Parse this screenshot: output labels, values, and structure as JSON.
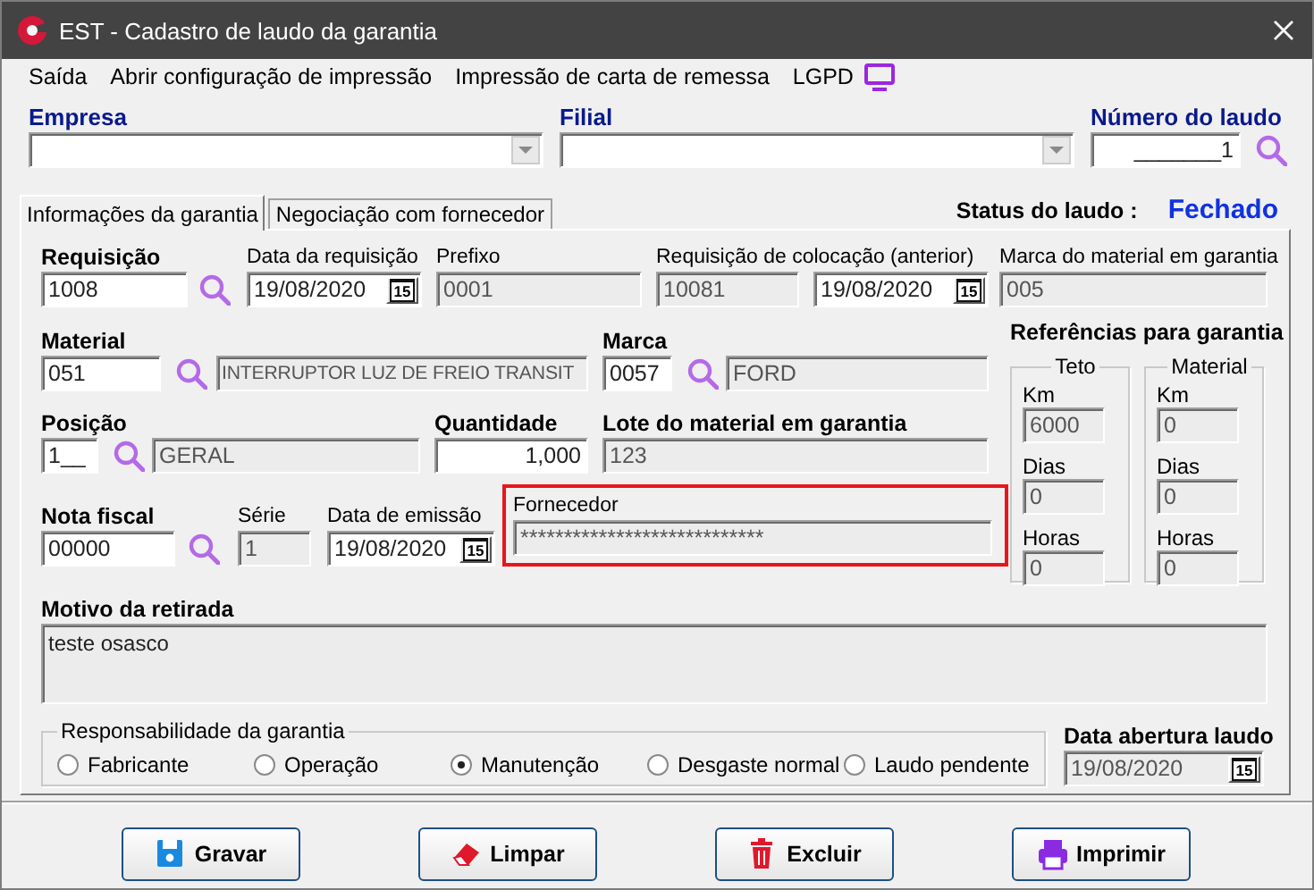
{
  "window": {
    "title": "EST - Cadastro de laudo da garantia"
  },
  "menu": [
    {
      "label": "Saída",
      "kind": "text"
    },
    {
      "label": "Abrir configuração de impressão",
      "kind": "text"
    },
    {
      "label": "Impressão de carta de remessa",
      "kind": "text"
    },
    {
      "label": "LGPD",
      "kind": "text_with_icon"
    }
  ],
  "header": {
    "empresa": {
      "label": "Empresa"
    },
    "filial": {
      "label": "Filial"
    },
    "numero_laudo": {
      "label": "Número do laudo",
      "value": "_______1"
    }
  },
  "tabs": [
    {
      "label": "Informações da garantia",
      "selected": true
    },
    {
      "label": "Negociação com fornecedor",
      "selected": false
    }
  ],
  "status": {
    "label": "Status do laudo :",
    "value": "Fechado"
  },
  "form": {
    "requisicao": {
      "label": "Requisição",
      "value": "1008",
      "bold": true,
      "disabled": false
    },
    "data_requisicao": {
      "label": "Data da requisição",
      "value": "19/08/2020",
      "button": "15",
      "bold": false,
      "disabled": false
    },
    "prefixo": {
      "label": "Prefixo",
      "value": "0001",
      "bold": false,
      "disabled": true
    },
    "requisicao_colocacao": {
      "label": "Requisição de colocação (anterior)",
      "value": "10081",
      "bold": false,
      "disabled": true
    },
    "data_colocacao": {
      "value": "19/08/2020",
      "button": "15",
      "disabled": false
    },
    "marca_material": {
      "label": "Marca do material em garantia",
      "value": "005",
      "bold": false,
      "disabled": true
    },
    "material": {
      "label": "Material",
      "value": "051",
      "bold": true,
      "disabled": false
    },
    "material_descricao": {
      "value": "INTERRUPTOR LUZ DE FREIO TRANSIT",
      "disabled": true
    },
    "marca": {
      "label": "Marca",
      "value": "0057",
      "bold": true,
      "disabled": false
    },
    "marca_descricao": {
      "value": "FORD",
      "disabled": true
    },
    "posicao": {
      "label": "Posição",
      "value": "1__",
      "bold": true,
      "disabled": false
    },
    "posicao_descricao": {
      "value": "GERAL",
      "disabled": true
    },
    "quantidade": {
      "label": "Quantidade",
      "value": "1,000",
      "bold": true,
      "disabled": false
    },
    "lote": {
      "label": "Lote do material em garantia",
      "value": "123",
      "bold": true,
      "disabled": true
    },
    "nota_fiscal": {
      "label": "Nota fiscal",
      "value": "00000",
      "bold": true,
      "disabled": false
    },
    "serie": {
      "label": "Série",
      "value": "1",
      "bold": false,
      "disabled": true
    },
    "data_emissao": {
      "label": "Data de emissão",
      "value": "19/08/2020",
      "button": "15",
      "bold": false,
      "disabled": false
    },
    "fornecedor": {
      "label": "Fornecedor",
      "value": "****************************",
      "bold": false,
      "disabled": true,
      "highlighted": true
    }
  },
  "references": {
    "title": "Referências para garantia",
    "groups": [
      {
        "title": "Teto",
        "fields": [
          {
            "label": "Km",
            "value": "6000"
          },
          {
            "label": "Dias",
            "value": "0"
          },
          {
            "label": "Horas",
            "value": "0"
          }
        ]
      },
      {
        "title": "Material",
        "fields": [
          {
            "label": "Km",
            "value": "0"
          },
          {
            "label": "Dias",
            "value": "0"
          },
          {
            "label": "Horas",
            "value": "0"
          }
        ]
      }
    ]
  },
  "motivo": {
    "label": "Motivo da retirada",
    "value": "teste osasco"
  },
  "responsabilidade": {
    "title": "Responsabilidade da garantia",
    "options": [
      {
        "label": "Fabricante",
        "selected": false
      },
      {
        "label": "Operação",
        "selected": false
      },
      {
        "label": "Manutenção",
        "selected": true
      },
      {
        "label": "Desgaste normal",
        "selected": false
      },
      {
        "label": "Laudo pendente",
        "selected": false
      }
    ]
  },
  "data_abertura": {
    "label": "Data abertura laudo",
    "value": "19/08/2020",
    "button": "15",
    "disabled": true
  },
  "buttons": [
    {
      "label": "Gravar",
      "kind": "save"
    },
    {
      "label": "Limpar",
      "kind": "clear"
    },
    {
      "label": "Excluir",
      "kind": "delete"
    },
    {
      "label": "Imprimir",
      "kind": "print"
    }
  ]
}
